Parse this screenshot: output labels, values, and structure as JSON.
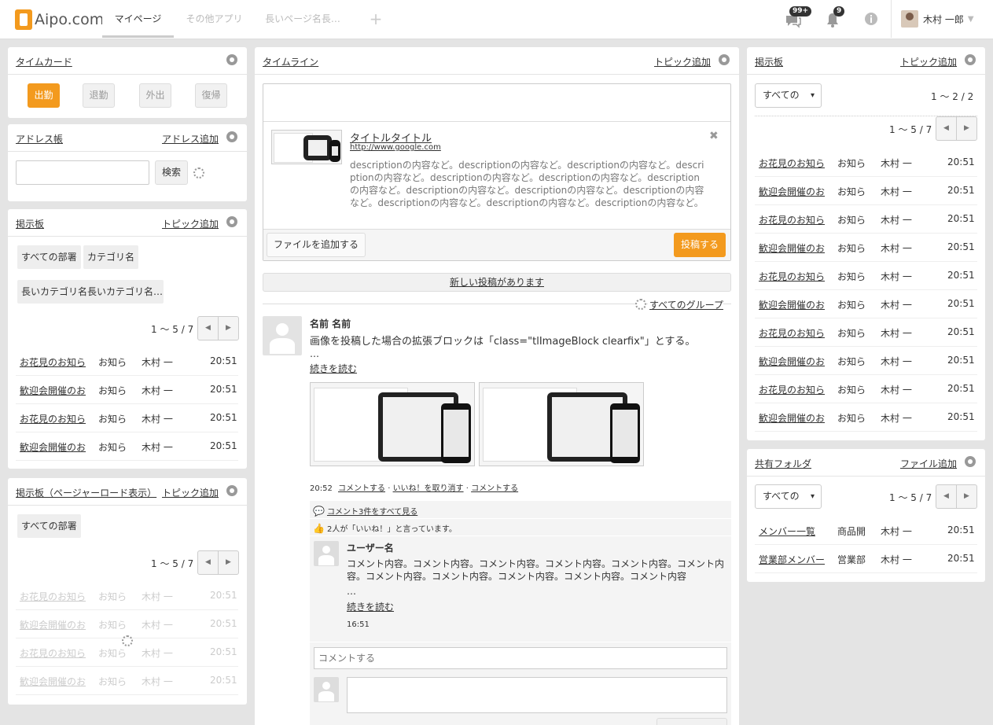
{
  "app": {
    "logo": "Aipo.com"
  },
  "header": {
    "tabs": [
      "マイページ",
      "その他アプリ",
      "長いページ名長…"
    ],
    "add_tab": "+",
    "messages_badge": "99+",
    "notifications_badge": "9",
    "user_name": "木村 一郎"
  },
  "timecard": {
    "title": "タイムカード",
    "buttons": [
      "出勤",
      "退勤",
      "外出",
      "復帰"
    ]
  },
  "address": {
    "title": "アドレス帳",
    "add": "アドレス追加",
    "search_button": "検索",
    "search_value": ""
  },
  "board_left": {
    "title": "掲示板",
    "add": "トピック追加",
    "filters": [
      "すべての部署",
      "カテゴリ名",
      "長いカテゴリ名長いカテゴリ名…"
    ],
    "pager": "1 ～ 5 / 7",
    "rows": [
      [
        "お花見のお知ら",
        "お知ら",
        "木村 一",
        "20:51"
      ],
      [
        "歓迎会開催のお",
        "お知ら",
        "木村 一",
        "20:51"
      ],
      [
        "お花見のお知ら",
        "お知ら",
        "木村 一",
        "20:51"
      ],
      [
        "歓迎会開催のお",
        "お知ら",
        "木村 一",
        "20:51"
      ]
    ]
  },
  "board_pager": {
    "title": "掲示板（ページャーロード表示）",
    "add": "トピック追加",
    "filter": "すべての部署",
    "pager": "1 ～ 5 / 7",
    "rows": [
      [
        "お花見のお知ら",
        "お知ら",
        "木村 一",
        "20:51"
      ],
      [
        "歓迎会開催のお",
        "お知ら",
        "木村 一",
        "20:51"
      ],
      [
        "お花見のお知ら",
        "お知ら",
        "木村 一",
        "20:51"
      ],
      [
        "歓迎会開催のお",
        "お知ら",
        "木村 一",
        "20:51"
      ]
    ]
  },
  "timeline": {
    "title": "タイムライン",
    "add": "トピック追加",
    "link_preview": {
      "title": "タイトルタイトル",
      "url": "http://www.google.com",
      "description": "descriptionの内容など。descriptionの内容など。descriptionの内容など。descriptionの内容など。descriptionの内容など。descriptionの内容など。descriptionの内容など。descriptionの内容など。descriptionの内容など。descriptionの内容など。descriptionの内容など。descriptionの内容など。descriptionの内容など。"
    },
    "add_file": "ファイルを追加する",
    "post": "投稿する",
    "new_posts": "新しい投稿があります",
    "group_filter": "すべてのグループ",
    "post_item": {
      "author": "名前 名前",
      "text": "画像を投稿した場合の拡張ブロックは「class=\"tlImageBlock clearfix\"」とする。",
      "ellipsis": "…",
      "read_more": "続きを読む",
      "time": "20:52",
      "actions": [
        "コメントする",
        "いいね！を取り消す",
        "コメントする"
      ],
      "show_comments": "コメント3件をすべて見る",
      "likes": "2人が「いいね！」と言っています。",
      "comment": {
        "author": "ユーザー名",
        "text": "コメント内容。コメント内容。コメント内容。コメント内容。コメント内容。コメント内容。コメント内容。コメント内容。コメント内容。コメント内容。コメント内容",
        "ellipsis": "…",
        "read_more": "続きを読む",
        "time": "16:51"
      },
      "comment_placeholder": "コメントする"
    }
  },
  "board_right": {
    "title": "掲示板",
    "add": "トピック追加",
    "filter": "すべての",
    "top_pager": "1 ～ 2 / 2",
    "pager": "1 ～ 5 / 7",
    "rows": [
      [
        "お花見のお知ら",
        "お知ら",
        "木村 一",
        "20:51"
      ],
      [
        "歓迎会開催のお",
        "お知ら",
        "木村 一",
        "20:51"
      ],
      [
        "お花見のお知ら",
        "お知ら",
        "木村 一",
        "20:51"
      ],
      [
        "歓迎会開催のお",
        "お知ら",
        "木村 一",
        "20:51"
      ],
      [
        "お花見のお知ら",
        "お知ら",
        "木村 一",
        "20:51"
      ],
      [
        "歓迎会開催のお",
        "お知ら",
        "木村 一",
        "20:51"
      ],
      [
        "お花見のお知ら",
        "お知ら",
        "木村 一",
        "20:51"
      ],
      [
        "歓迎会開催のお",
        "お知ら",
        "木村 一",
        "20:51"
      ],
      [
        "お花見のお知ら",
        "お知ら",
        "木村 一",
        "20:51"
      ],
      [
        "歓迎会開催のお",
        "お知ら",
        "木村 一",
        "20:51"
      ]
    ]
  },
  "folder": {
    "title": "共有フォルダ",
    "add": "ファイル追加",
    "filter": "すべての",
    "pager": "1 ～ 5 / 7",
    "rows": [
      [
        "メンバー一覧",
        "商品開",
        "木村 一",
        "20:51"
      ],
      [
        "営業部メンバー",
        "営業部",
        "木村 一",
        "20:51"
      ]
    ]
  },
  "colors": {
    "accent": "#f39a1e",
    "background": "#e4e4e4"
  }
}
